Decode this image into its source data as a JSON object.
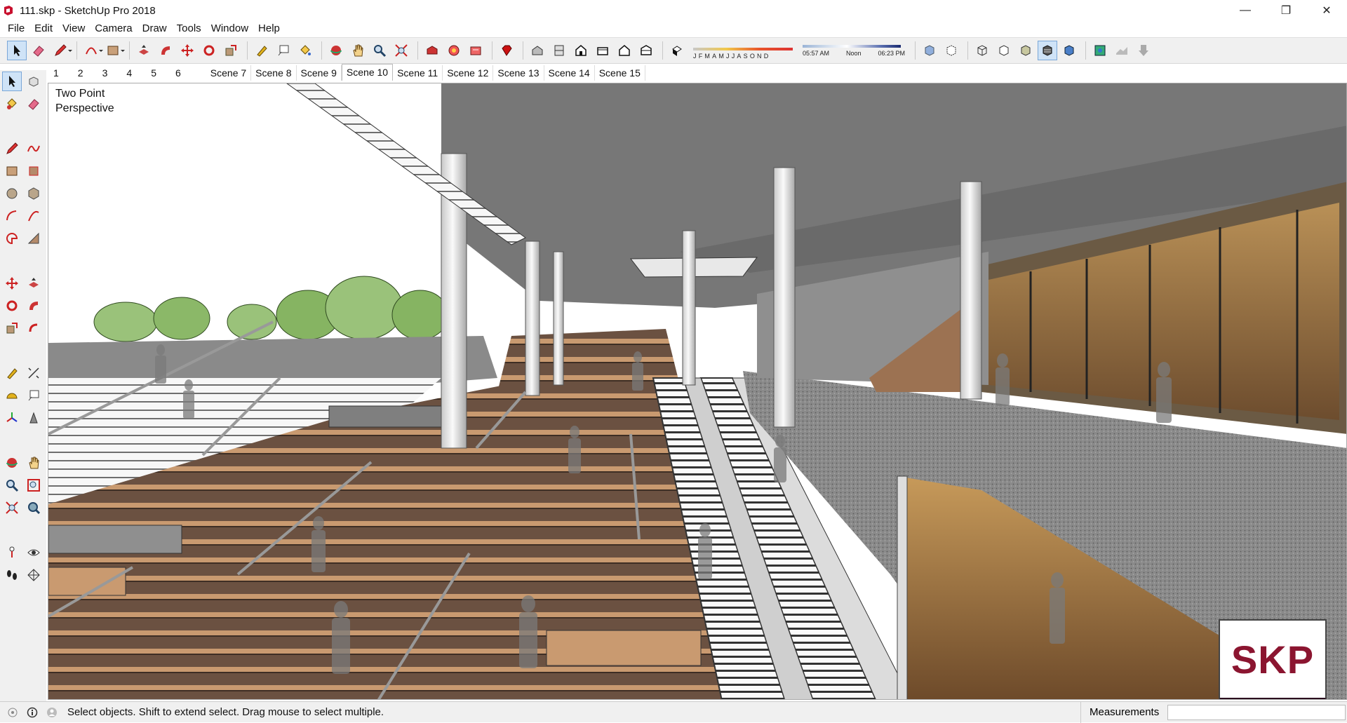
{
  "window": {
    "title": "111.skp - SketchUp Pro 2018",
    "minimize": "—",
    "maximize": "❐",
    "close": "✕"
  },
  "menu": [
    "File",
    "Edit",
    "View",
    "Camera",
    "Draw",
    "Tools",
    "Window",
    "Help"
  ],
  "shadows": {
    "months": [
      "J",
      "F",
      "M",
      "A",
      "M",
      "J",
      "J",
      "A",
      "S",
      "O",
      "N",
      "D"
    ],
    "time_start": "05:57 AM",
    "time_mid": "Noon",
    "time_end": "06:23 PM"
  },
  "scenes": {
    "tabs": [
      "1",
      "2",
      "3",
      "4",
      "5",
      "6",
      "Scene 7",
      "Scene 8",
      "Scene 9",
      "Scene 10",
      "Scene 11",
      "Scene 12",
      "Scene 13",
      "Scene 14",
      "Scene 15"
    ],
    "active_index": 9
  },
  "viewport": {
    "label": "Two Point\nPerspective"
  },
  "logo": {
    "text": "SKP"
  },
  "status": {
    "hint": "Select objects. Shift to extend select. Drag mouse to select multiple.",
    "measurements_label": "Measurements",
    "measurements_value": ""
  },
  "colors": {
    "toolbar_bg": "#f0f0f0",
    "logo_red": "#8b1530",
    "active_tool": "#cfe3f7"
  }
}
